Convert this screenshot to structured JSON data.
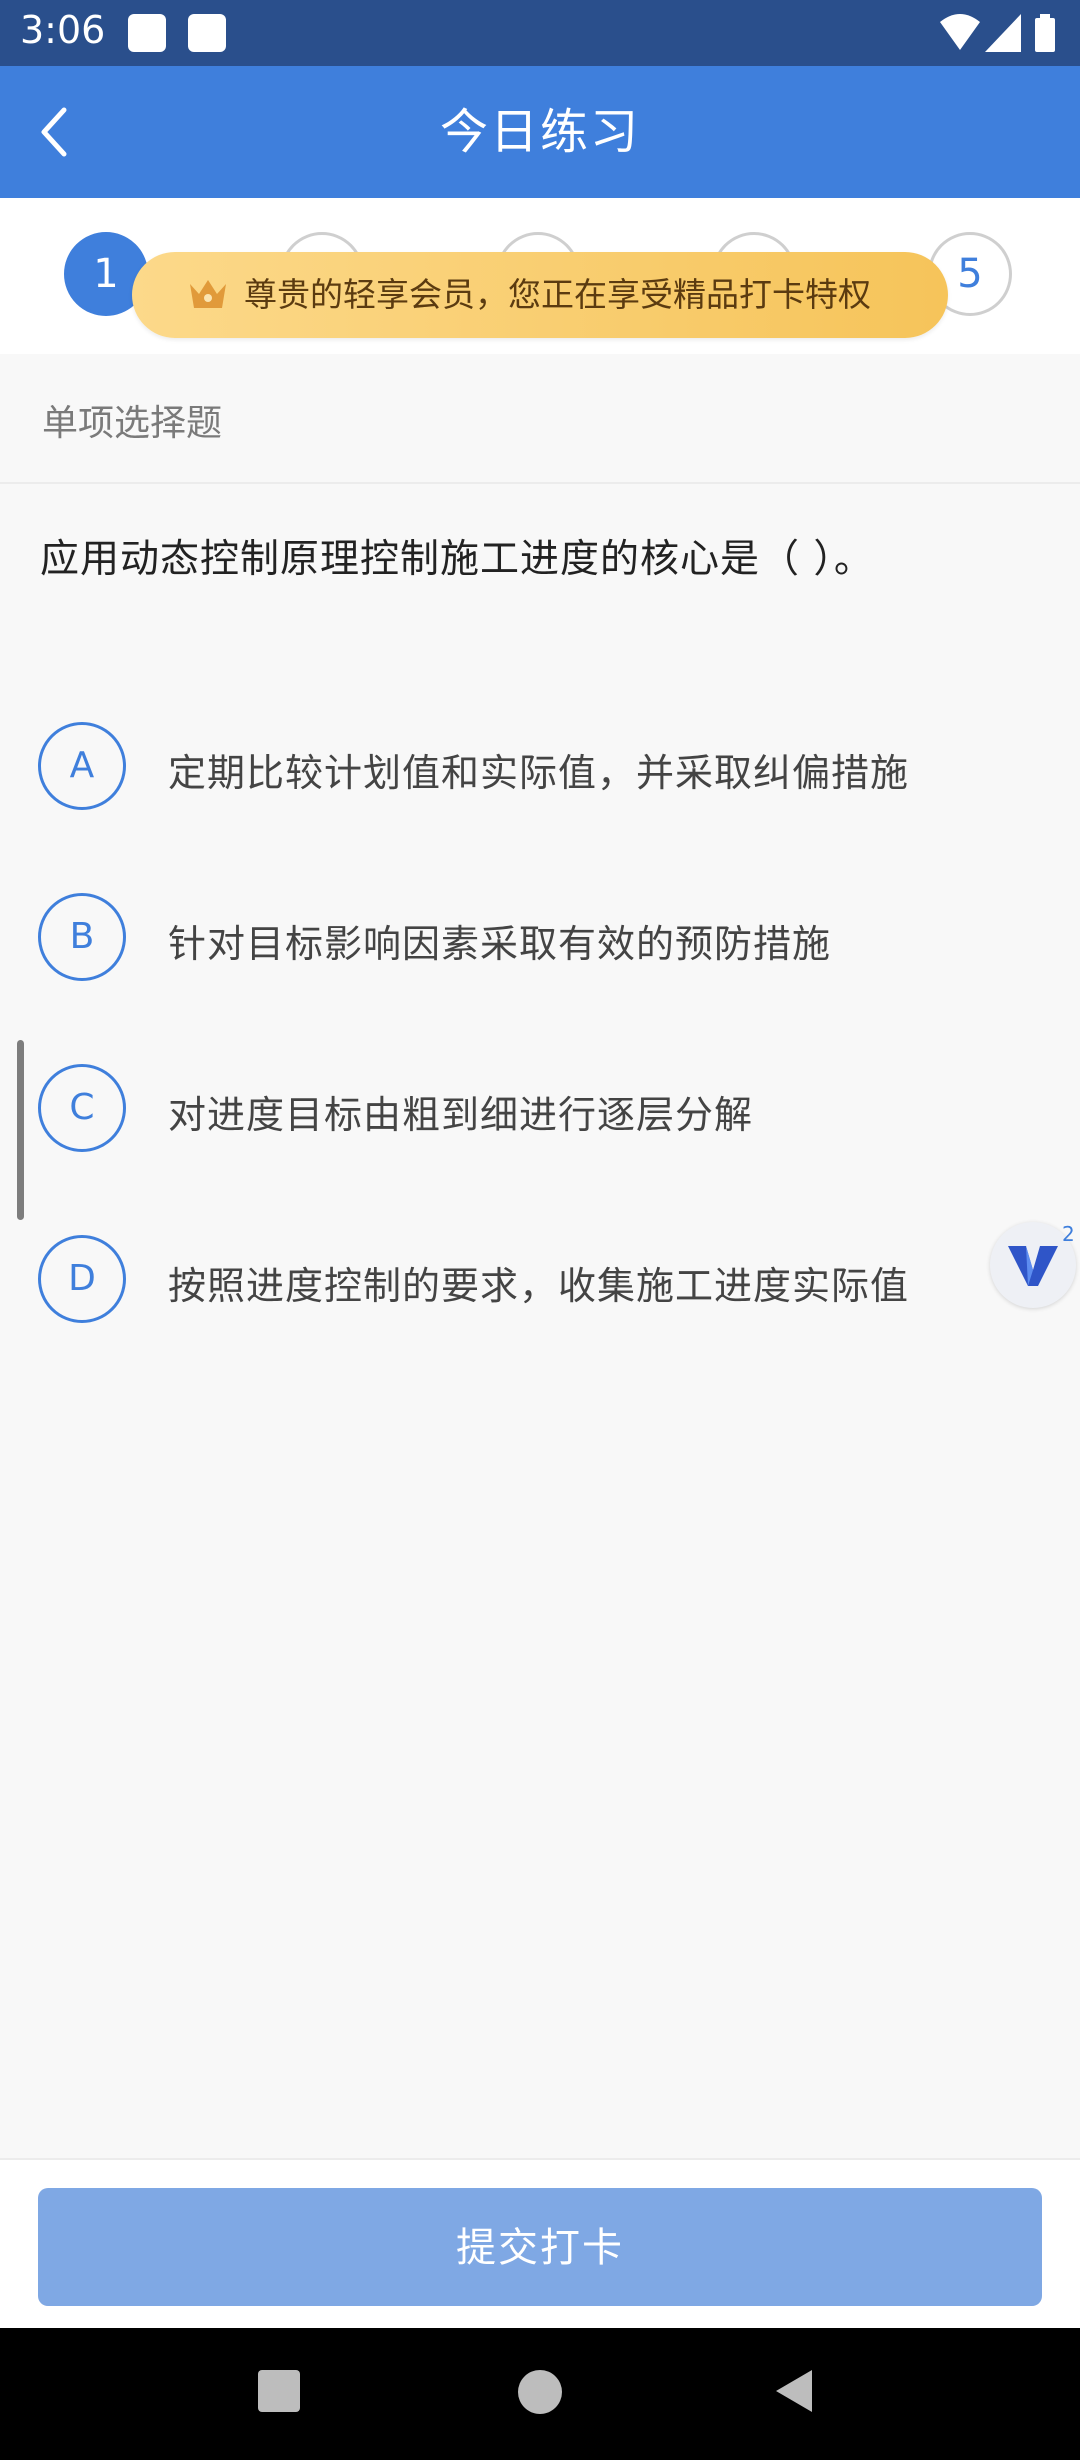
{
  "status_bar": {
    "time": "3:06"
  },
  "app_bar": {
    "title": "今日练习"
  },
  "steps": [
    "1",
    "",
    "",
    "",
    "5"
  ],
  "banner": {
    "text": "尊贵的轻享会员，您正在享受精品打卡特权"
  },
  "section": {
    "title": "单项选择题"
  },
  "question": {
    "text": "应用动态控制原理控制施工进度的核心是（    ）。"
  },
  "options": [
    {
      "key": "A",
      "text": "定期比较计划值和实际值，并采取纠偏措施"
    },
    {
      "key": "B",
      "text": "针对目标影响因素采取有效的预防措施"
    },
    {
      "key": "C",
      "text": "对进度目标由粗到细进行逐层分解"
    },
    {
      "key": "D",
      "text": "按照进度控制的要求，收集施工进度实际值"
    }
  ],
  "floating_badge": {
    "count": "2"
  },
  "footer": {
    "submit_label": "提交打卡"
  },
  "colors": {
    "primary": "#3f7fdc",
    "status_bar": "#2a4f8c",
    "banner": "#f6c45a",
    "submit": "#7fa8e4"
  }
}
